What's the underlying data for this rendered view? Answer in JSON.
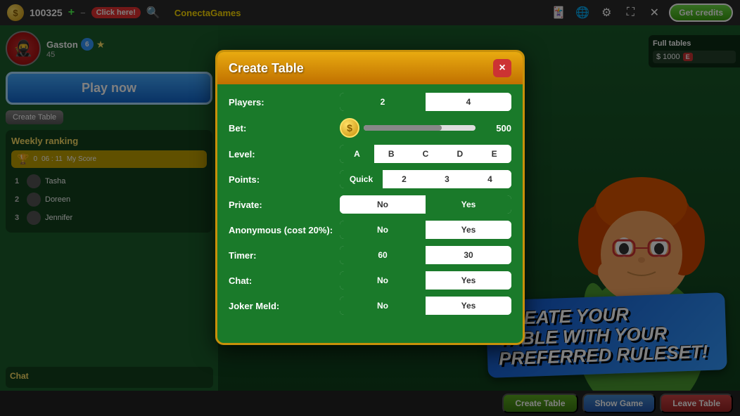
{
  "topbar": {
    "score": "100325",
    "add_label": "+",
    "click_label": "Click here!",
    "logo": "ConectaGames",
    "get_credits": "Get credits"
  },
  "player": {
    "name": "Gaston",
    "level": "6",
    "score_value": "45"
  },
  "play_now": "Play now",
  "create_table_small": "Create Table",
  "weekly_ranking": {
    "title": "Weekly ranking",
    "timer": "06 : 11",
    "my_score_label": "My Score",
    "items": [
      {
        "rank": "1",
        "name": "Tasha"
      },
      {
        "rank": "2",
        "name": "Doreen"
      },
      {
        "rank": "3",
        "name": "Jennifer"
      }
    ]
  },
  "chat": {
    "title": "Chat"
  },
  "full_tables": {
    "title": "Full tables",
    "amount": "$ 1000",
    "badge": "E"
  },
  "modal": {
    "title": "Create Table",
    "close": "×",
    "fields": {
      "players": {
        "label": "Players:",
        "options": [
          "2",
          "4"
        ],
        "active": 0
      },
      "bet": {
        "label": "Bet:",
        "value": "500"
      },
      "level": {
        "label": "Level:",
        "options": [
          "A",
          "B",
          "C",
          "D",
          "E"
        ],
        "active": 0
      },
      "points": {
        "label": "Points:",
        "options": [
          "Quick",
          "2",
          "3",
          "4"
        ],
        "active": 0
      },
      "private": {
        "label": "Private:",
        "options": [
          "No",
          "Yes"
        ],
        "active": 1
      },
      "anonymous": {
        "label": "Anonymous (cost 20%):",
        "options": [
          "No",
          "Yes"
        ],
        "active": 0
      },
      "timer": {
        "label": "Timer:",
        "options": [
          "60",
          "30"
        ],
        "active": 0
      },
      "chat": {
        "label": "Chat:",
        "options": [
          "No",
          "Yes"
        ],
        "active": 0
      },
      "joker_meld": {
        "label": "Joker Meld:",
        "options": [
          "No",
          "Yes"
        ],
        "active": 0
      }
    }
  },
  "promo": {
    "line1": "CREATE YOUR",
    "line2": "TABLE WITH YOUR",
    "line3": "PREFERRED RULESET!"
  },
  "bottom": {
    "create_table": "Create Table",
    "show_game": "Show Game",
    "leave_table": "Leave Table"
  }
}
